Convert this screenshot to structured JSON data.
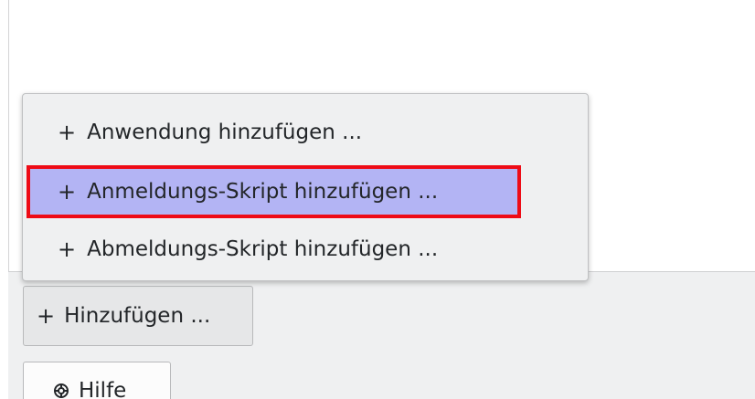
{
  "popup_menu": {
    "items": [
      {
        "label": "Anwendung hinzufügen ...",
        "icon": "plus-icon"
      },
      {
        "label": "Anmeldungs-Skript hinzufügen ...",
        "icon": "plus-icon",
        "highlighted": true
      },
      {
        "label": "Abmeldungs-Skript hinzufügen ...",
        "icon": "plus-icon"
      }
    ]
  },
  "buttons": {
    "add_label": "Hinzufügen ...",
    "help_label": "Hilfe"
  },
  "icons": {
    "plus": "+"
  },
  "colors": {
    "highlight_fill": "#b3b4f4",
    "highlight_border": "#ee0b16",
    "panel_bg": "#eff0f1"
  }
}
